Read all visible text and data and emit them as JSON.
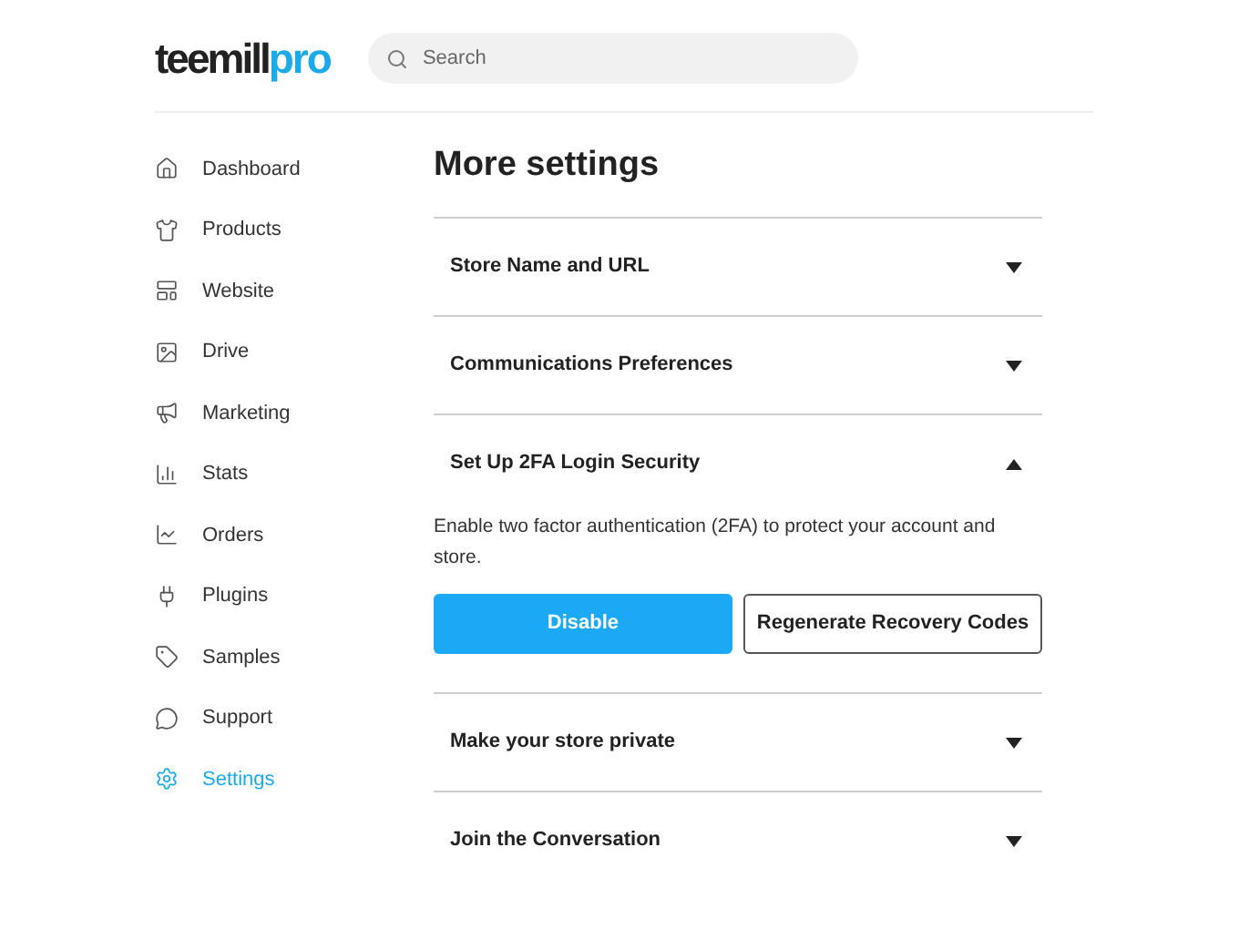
{
  "logo": {
    "part_1": "teemill",
    "part_2": "pro"
  },
  "search": {
    "placeholder": "Search"
  },
  "sidebar": {
    "items": [
      {
        "label": "Dashboard",
        "selected": false
      },
      {
        "label": "Products",
        "selected": false
      },
      {
        "label": "Website",
        "selected": false
      },
      {
        "label": "Drive",
        "selected": false
      },
      {
        "label": "Marketing",
        "selected": false
      },
      {
        "label": "Stats",
        "selected": false
      },
      {
        "label": "Orders",
        "selected": false
      },
      {
        "label": "Plugins",
        "selected": false
      },
      {
        "label": "Samples",
        "selected": false
      },
      {
        "label": "Support",
        "selected": false
      },
      {
        "label": "Settings",
        "selected": true
      }
    ]
  },
  "page_title": "More settings",
  "sections": [
    {
      "title": "Store Name and URL",
      "expanded": false
    },
    {
      "title": "Communications Preferences",
      "expanded": false
    },
    {
      "title": "Set Up 2FA Login Security",
      "expanded": true,
      "description": "Enable two factor authentication (2FA) to protect your account and store.",
      "buttons": [
        {
          "label": "Disable",
          "kind": "primary"
        },
        {
          "label": "Regenerate Recovery Codes",
          "kind": "outline"
        }
      ]
    },
    {
      "title": "Make your store private",
      "expanded": false
    },
    {
      "title": "Join the Conversation",
      "expanded": false
    }
  ]
}
